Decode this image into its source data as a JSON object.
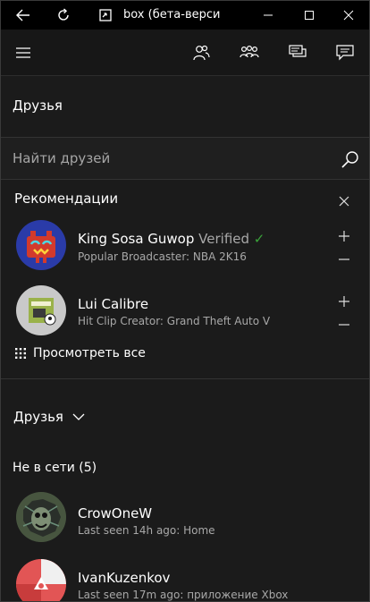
{
  "window": {
    "title": "box (бета-верси"
  },
  "page": {
    "heading": "Друзья",
    "search": {
      "placeholder": "Найти друзей",
      "value": ""
    }
  },
  "recommendations": {
    "title": "Рекомендации",
    "items": [
      {
        "name": "King Sosa Guwop",
        "badge": "Verified",
        "check": "✓",
        "subtitle": "Popular Broadcaster: NBA 2K16"
      },
      {
        "name": "Lui Calibre",
        "subtitle": "Hit Clip Creator: Grand Theft Auto V"
      }
    ],
    "view_all_label": "Просмотреть все"
  },
  "friends": {
    "dropdown_label": "Друзья",
    "offline_header": "Не в сети (5)",
    "items": [
      {
        "name": "CrowOneW",
        "status": "Last seen 14h ago: Home"
      },
      {
        "name": "IvanKuzenkov",
        "status": "Last seen 17m ago: приложение Xbox"
      }
    ]
  },
  "icons": {
    "back": "back-arrow-icon",
    "refresh": "refresh-icon",
    "app": "app-icon",
    "minimize": "minimize-icon",
    "maximize": "maximize-icon",
    "close": "close-icon",
    "menu": "hamburger-menu-icon",
    "friends": "friends-icon",
    "party": "party-icon",
    "messages": "messages-icon",
    "notifications": "notifications-icon"
  },
  "colors": {
    "background": "#1b1b1b",
    "titlebar": "#000000",
    "verified": "#3aa33a"
  }
}
